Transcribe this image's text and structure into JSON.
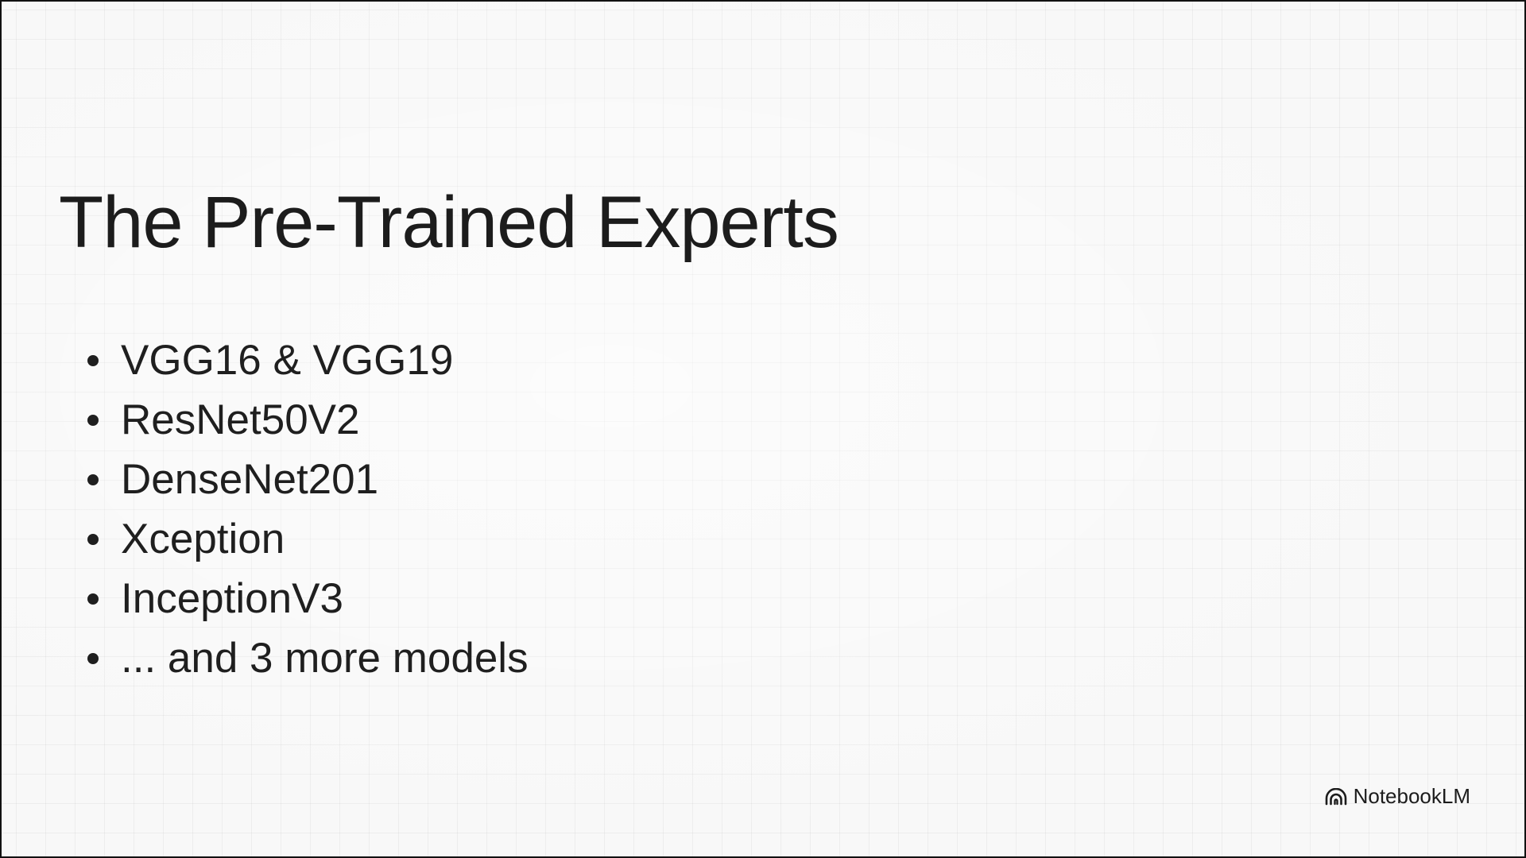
{
  "slide": {
    "title": "The Pre-Trained Experts",
    "bullets": [
      "VGG16 & VGG19",
      "ResNet50V2",
      "DenseNet201",
      "Xception",
      "InceptionV3",
      "... and 3 more models"
    ]
  },
  "brand": {
    "label": "NotebookLM",
    "icon": "notebooklm-logo-icon"
  },
  "colors": {
    "text": "#1f1f1f",
    "background": "#f8f8f8",
    "frame": "#111111"
  }
}
